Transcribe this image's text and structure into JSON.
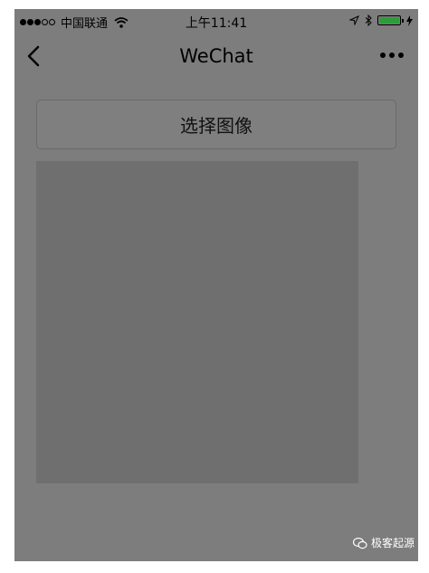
{
  "status_bar": {
    "carrier": "中国联通",
    "time": "上午11:41",
    "battery_level": 1.0
  },
  "nav": {
    "title": "WeChat",
    "back_icon": "chevron-left-icon",
    "more_icon": "ellipsis-icon"
  },
  "main": {
    "choose_image_label": "选择图像"
  },
  "watermark": {
    "text": "极客起源"
  },
  "colors": {
    "overlay": "#7d7d7d",
    "preview": "#6f6f6f",
    "battery": "#2e9c3a"
  }
}
